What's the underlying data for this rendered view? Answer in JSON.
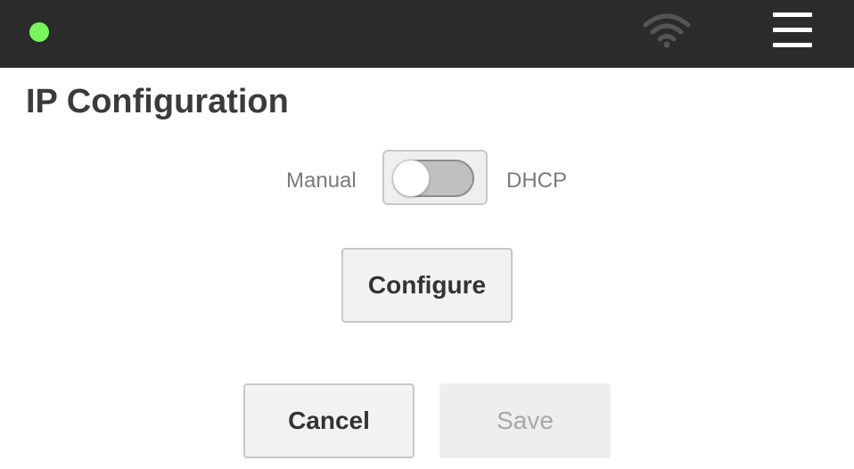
{
  "header": {
    "status_indicator_color": "#77f55c",
    "wifi_icon": "wifi-icon",
    "menu_icon": "hamburger-menu-icon"
  },
  "page": {
    "title": "IP Configuration"
  },
  "mode_toggle": {
    "left_label": "Manual",
    "right_label": "DHCP",
    "selected": "Manual"
  },
  "buttons": {
    "configure_label": "Configure",
    "cancel_label": "Cancel",
    "save_label": "Save",
    "save_enabled": false
  }
}
